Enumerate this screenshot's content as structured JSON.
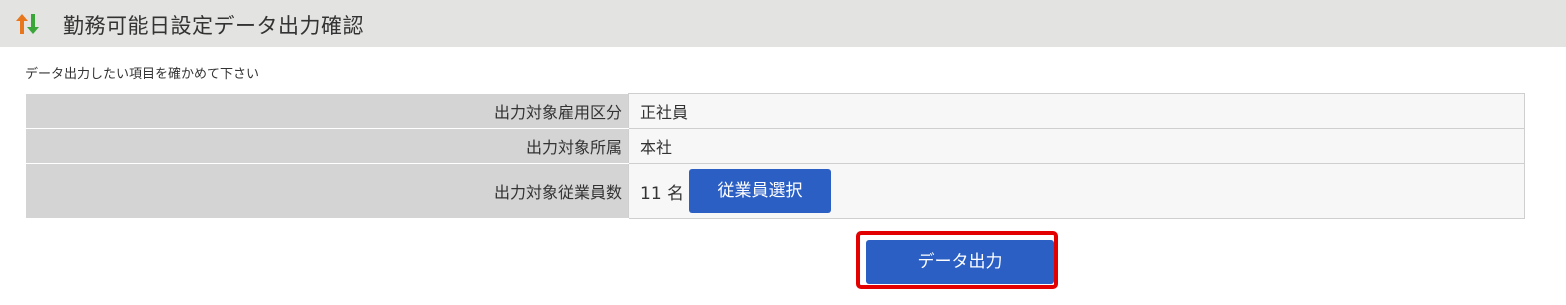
{
  "header": {
    "icon": "up-down-arrows-icon",
    "title": "勤務可能日設定データ出力確認"
  },
  "instruction": "データ出力したい項目を確かめて下さい",
  "settings": {
    "rows": [
      {
        "label": "出力対象雇用区分",
        "value": "正社員"
      },
      {
        "label": "出力対象所属",
        "value": "本社"
      },
      {
        "label": "出力対象従業員数",
        "value": "11 名"
      }
    ],
    "employee_select_label": "従業員選択"
  },
  "actions": {
    "output_label": "データ出力",
    "highlight_color": "#e30000"
  },
  "colors": {
    "accent": "#2b5fc4",
    "header_bg": "#e3e3e1"
  }
}
